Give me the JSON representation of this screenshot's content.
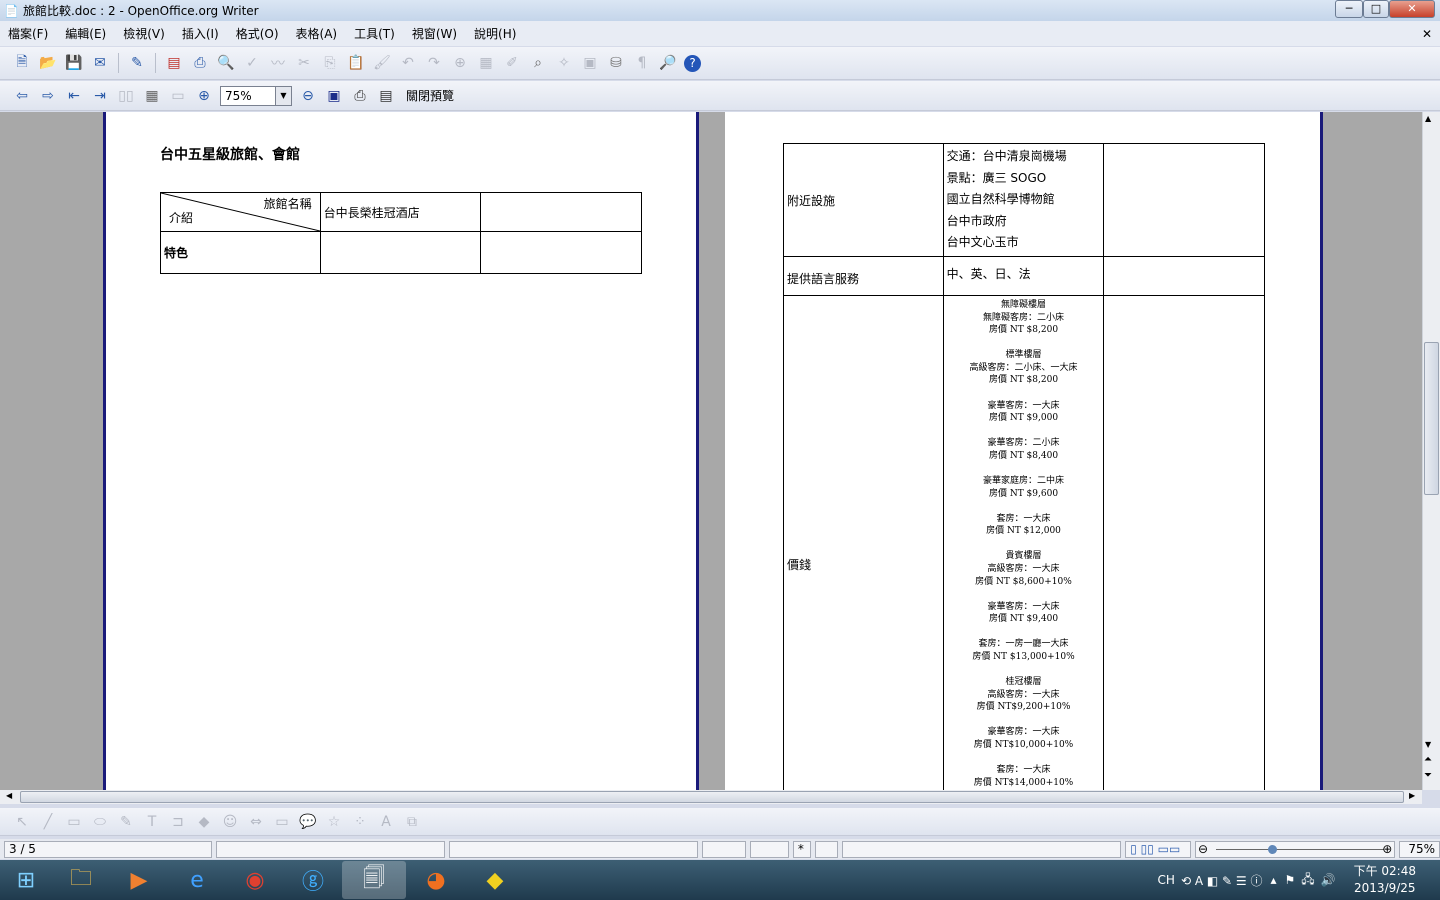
{
  "window": {
    "title": "旅館比較.doc : 2 - OpenOffice.org Writer",
    "minimize": "─",
    "maximize": "□",
    "close": "✕",
    "doc_close": "✕"
  },
  "menu": [
    "檔案(F)",
    "編輯(E)",
    "檢視(V)",
    "插入(I)",
    "格式(O)",
    "表格(A)",
    "工具(T)",
    "視窗(W)",
    "說明(H)"
  ],
  "toolbar2": {
    "zoom_value": "75%",
    "close_preview": "關閉預覽"
  },
  "page_left": {
    "heading": "台中五星級旅館、會館",
    "table": {
      "diag_top": "旅館名稱",
      "diag_bottom": "介紹",
      "hotel1": "台中長榮桂冠酒店",
      "row2_label": "特色"
    }
  },
  "page_right": {
    "rows": [
      {
        "label": "附近設施",
        "values": [
          "交通：台中清泉崗機場",
          "景點：廣三 SOGO",
          "國立自然科學博物館",
          "台中市政府",
          "台中文心玉市"
        ]
      },
      {
        "label": "提供語言服務",
        "values": [
          "中、英、日、法"
        ]
      },
      {
        "label": "價錢",
        "groups": [
          [
            "無障礙樓層",
            "無障礙客房：二小床",
            "房價 NT $8,200"
          ],
          [
            "標準樓層",
            "高級客房：二小床、一大床",
            "房價 NT $8,200"
          ],
          [
            "豪華客房：一大床",
            "房價 NT $9,000"
          ],
          [
            "豪華客房：二小床",
            "房價 NT $8,400"
          ],
          [
            "豪華家庭房：二中床",
            "房價 NT $9,600"
          ],
          [
            "套房：一大床",
            "房價 NT $12,000"
          ],
          [
            "貴賓樓層",
            "高級客房：一大床",
            "房價 NT $8,600+10%"
          ],
          [
            "豪華客房：一大床",
            "房價 NT $9,400"
          ],
          [
            "套房：一房一廳一大床",
            "房價 NT $13,000+10%"
          ],
          [
            "桂冠樓層",
            "高級客房：一大床",
            "房價 NT$9,200+10%"
          ],
          [
            "豪華客房：一大床",
            "房價 NT$10,000+10%"
          ],
          [
            "套房：一大床",
            "房價 NT$14,000+10%"
          ]
        ]
      }
    ]
  },
  "statusbar": {
    "page": "3 / 5",
    "insert_mark": "*",
    "zoom": "75%",
    "zoom_slider_percent": 75
  },
  "taskbar": {
    "lang": "CH",
    "time": "下午 02:48",
    "date": "2013/9/25"
  }
}
